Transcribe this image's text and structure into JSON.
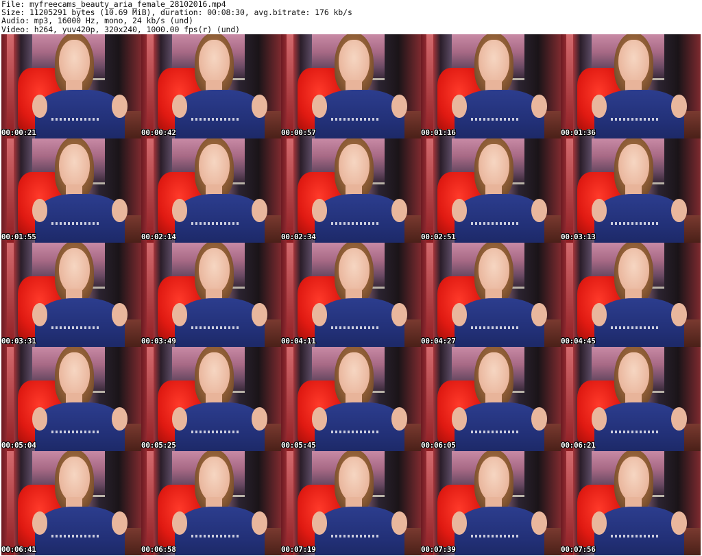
{
  "header": {
    "file_line": "File: myfreecams_beauty_aria_female_28102016.mp4",
    "size_line": "Size: 11205291 bytes (10.69 MiB), duration: 00:08:30, avg.bitrate: 176 kb/s",
    "audio_line": "Audio: mp3, 16000 Hz, mono, 24 kb/s (und)",
    "video_line": "Video: h264, yuv420p, 320x240, 1000.00 fps(r) (und)"
  },
  "timestamps": [
    "00:00:21",
    "00:00:42",
    "00:00:57",
    "00:01:16",
    "00:01:36",
    "00:01:55",
    "00:02:14",
    "00:02:34",
    "00:02:51",
    "00:03:13",
    "00:03:31",
    "00:03:49",
    "00:04:11",
    "00:04:27",
    "00:04:45",
    "00:05:04",
    "00:05:25",
    "00:05:45",
    "00:06:05",
    "00:06:21",
    "00:06:41",
    "00:06:58",
    "00:07:19",
    "00:07:39",
    "00:07:56"
  ]
}
